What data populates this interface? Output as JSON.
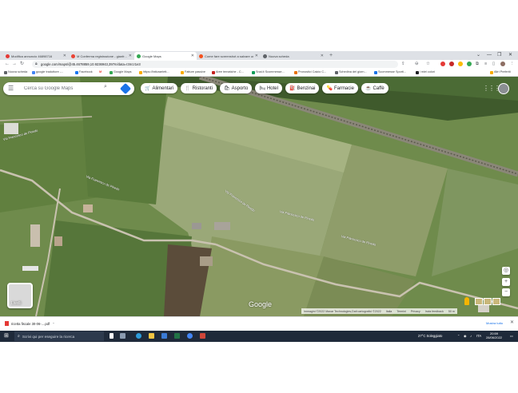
{
  "browser": {
    "tabs": [
      {
        "label": "Modifica annuncio 46898716",
        "color": "#e53935"
      },
      {
        "label": "M  Conferma registrazione - gianfr...",
        "color": "#ea4335"
      },
      {
        "label": "Google Maps",
        "color": "#34a853"
      },
      {
        "label": "Come fare screenshot a salvare un immagin...",
        "color": "#f4511e"
      },
      {
        "label": "Nuova scheda",
        "color": "#5f6368"
      }
    ],
    "new_tab": "+",
    "window_controls": [
      "⌄",
      "—",
      "❐",
      "✕"
    ],
    "url": "google.com/maps/@45.4678859,10.9236943,397m/data=!3m1!1e3",
    "toolbar_icons": [
      "share-icon",
      "zoom-icon",
      "star-icon"
    ],
    "bookmarks": [
      {
        "label": "Nuova scheda",
        "color": "#5f6368"
      },
      {
        "label": "google traduttore -...",
        "color": "#4285f4"
      },
      {
        "label": "Facebook",
        "color": "#1877f2"
      },
      {
        "label": "M",
        "color": "#ea4335"
      },
      {
        "label": "Google Maps",
        "color": "#34a853"
      },
      {
        "label": "https://fatturaelett...",
        "color": "#f9ab00"
      },
      {
        "label": "Fatture passive",
        "color": "#f9ab00"
      },
      {
        "label": "Aree tematiche - C...",
        "color": "#c5221f"
      },
      {
        "label": "Snai.it Scommesse...",
        "color": "#0f9d58"
      },
      {
        "label": "Pronostici Calcio C...",
        "color": "#e8710a"
      },
      {
        "label": "Schedina del giorn...",
        "color": "#5f6368"
      },
      {
        "label": "Scommesse Sporti...",
        "color": "#1a73e8"
      },
      {
        "label": "i miei colori",
        "color": "#202124"
      }
    ],
    "other_bookmarks": "Altri Preferiti"
  },
  "map": {
    "search_placeholder": "Cerca su Google Maps",
    "chips": [
      {
        "label": "Alimentari",
        "icon": "cart-icon",
        "glyph": "🛒"
      },
      {
        "label": "Ristoranti",
        "icon": "fork-knife-icon",
        "glyph": "🍴"
      },
      {
        "label": "Asporto",
        "icon": "bag-icon",
        "glyph": "🛍"
      },
      {
        "label": "Hotel",
        "icon": "bed-icon",
        "glyph": "🛏"
      },
      {
        "label": "Benzinai",
        "icon": "fuel-icon",
        "glyph": "⛽"
      },
      {
        "label": "Farmacie",
        "icon": "pharmacy-icon",
        "glyph": "💊"
      },
      {
        "label": "Caffè",
        "icon": "coffee-icon",
        "glyph": "☕"
      }
    ],
    "layers_label": "Livelli",
    "logo": "Google",
    "road_labels": [
      "Via Francesco de Pinedo",
      "Via Francesco de Pinedo",
      "Via Francesco de Pinedo",
      "Via Francesco de Pinedo",
      "Via Francesco de Pinedo"
    ],
    "attribution": [
      "Immagini ©2022 Maxar Technologies,Dati cartografici ©2022",
      "Italia",
      "Termini",
      "Privacy",
      "Invia feedback",
      "50 m"
    ],
    "zoom_in": "+",
    "zoom_out": "−"
  },
  "downloads": {
    "file": "ricetta fiscale 30-06-....pdf",
    "show_all": "Mostra tutto"
  },
  "taskbar": {
    "search_placeholder": "Scrivi qui per eseguire la ricerca",
    "weather": "27°C Soleggiato",
    "language": "ITA",
    "time": "20:59",
    "date": "28/06/2022"
  }
}
